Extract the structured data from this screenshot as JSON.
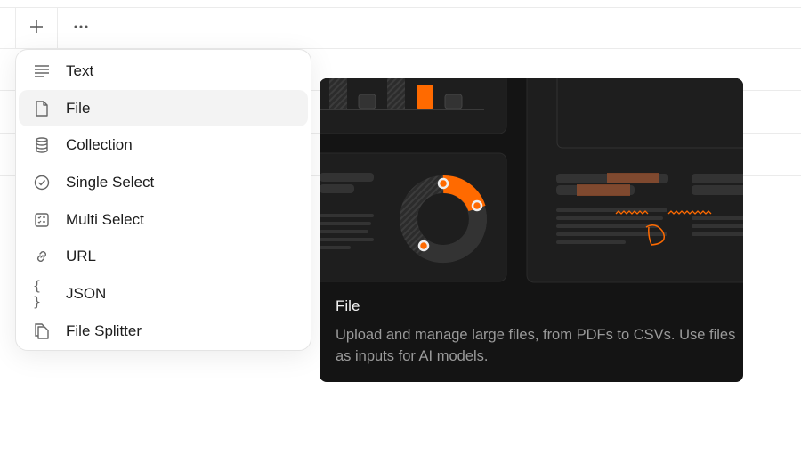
{
  "toolbar": {
    "add_icon": "plus-icon",
    "more_icon": "ellipsis-icon"
  },
  "menu": {
    "items": [
      {
        "label": "Text",
        "icon": "text-lines-icon"
      },
      {
        "label": "File",
        "icon": "file-icon",
        "selected": true
      },
      {
        "label": "Collection",
        "icon": "database-icon"
      },
      {
        "label": "Single Select",
        "icon": "check-circle-icon"
      },
      {
        "label": "Multi Select",
        "icon": "checklist-icon"
      },
      {
        "label": "URL",
        "icon": "link-icon"
      },
      {
        "label": "JSON",
        "icon": "braces-icon"
      },
      {
        "label": "File Splitter",
        "icon": "copy-file-icon"
      }
    ]
  },
  "preview": {
    "title": "File",
    "description": "Upload and manage large files, from PDFs to CSVs. Use files as inputs for AI models.",
    "accent": "#ff6a00"
  }
}
